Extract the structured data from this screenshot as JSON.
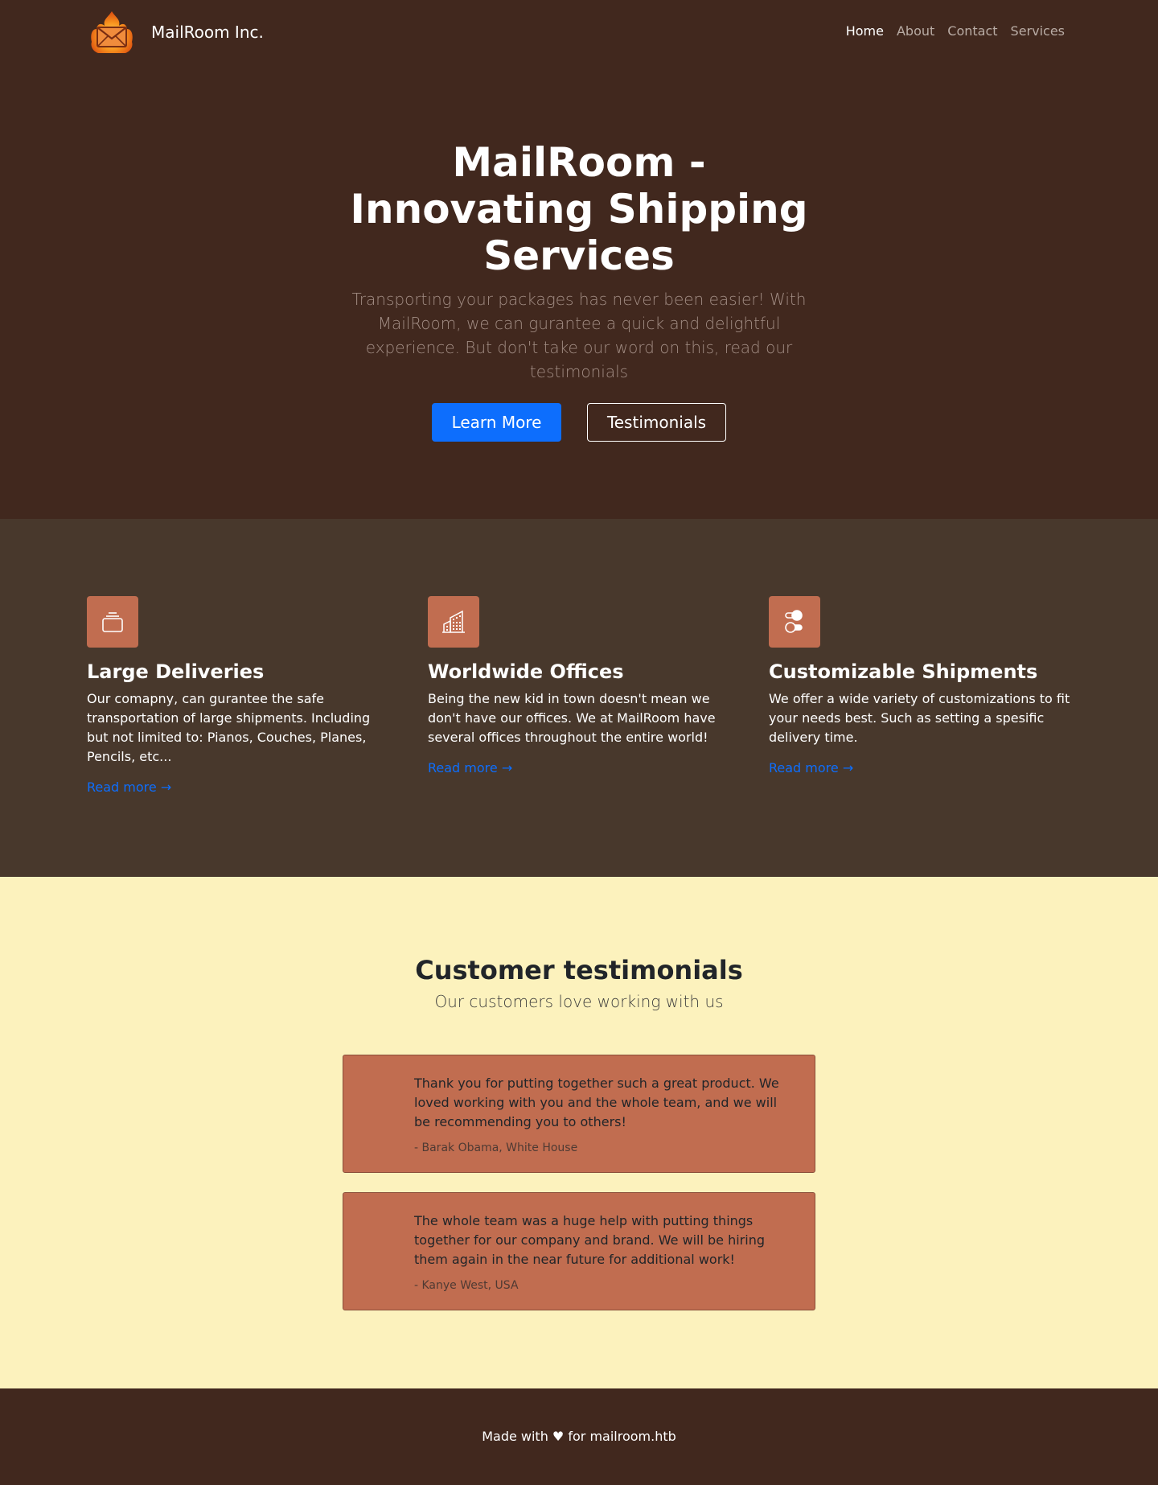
{
  "header": {
    "brand_name": "MailRoom Inc.",
    "nav": [
      {
        "label": "Home",
        "active": true
      },
      {
        "label": "About",
        "active": false
      },
      {
        "label": "Contact",
        "active": false
      },
      {
        "label": "Services",
        "active": false
      }
    ],
    "logo_icon": "flaming-envelope-icon"
  },
  "hero": {
    "title_lines": [
      "MailRoom -",
      "Innovating Shipping",
      "Services"
    ],
    "lead": "Transporting your packages has never been easier! With MailRoom, we can gurantee a quick and delightful experience. But don't take our word on this, read our testimonials",
    "primary_button": "Learn More",
    "secondary_button": "Testimonials"
  },
  "features": [
    {
      "icon": "collection-icon",
      "title": "Large Deliveries",
      "text": "Our comapny, can gurantee the safe transportation of large shipments. Including but not limited to: Pianos, Couches, Planes, Pencils, etc...",
      "link": "Read more →"
    },
    {
      "icon": "building-icon",
      "title": "Worldwide Offices",
      "text": "Being the new kid in town doesn't mean we don't have our offices. We at MailRoom have several offices throughout the entire world!",
      "link": "Read more →"
    },
    {
      "icon": "toggles-icon",
      "title": "Customizable Shipments",
      "text": "We offer a wide variety of customizations to fit your needs best. Such as setting a spesific delivery time.",
      "link": "Read more →"
    }
  ],
  "testimonials": {
    "title": "Customer testimonials",
    "subtitle": "Our customers love working with us",
    "items": [
      {
        "quote": "Thank you for putting together such a great product. We loved working with you and the whole team, and we will be recommending you to others!",
        "author": "- Barak Obama, White House"
      },
      {
        "quote": "The whole team was a huge help with putting things together for our company and brand. We will be hiring them again in the near future for additional work!",
        "author": "- Kanye West, USA"
      }
    ]
  },
  "footer": {
    "text": "Made with ♥ for mailroom.htb"
  },
  "colors": {
    "header_bg": "#41281e",
    "features_bg": "#48382c",
    "testimonials_bg": "#fcf2bd",
    "accent": "#c16d50",
    "primary": "#0d6efd"
  }
}
